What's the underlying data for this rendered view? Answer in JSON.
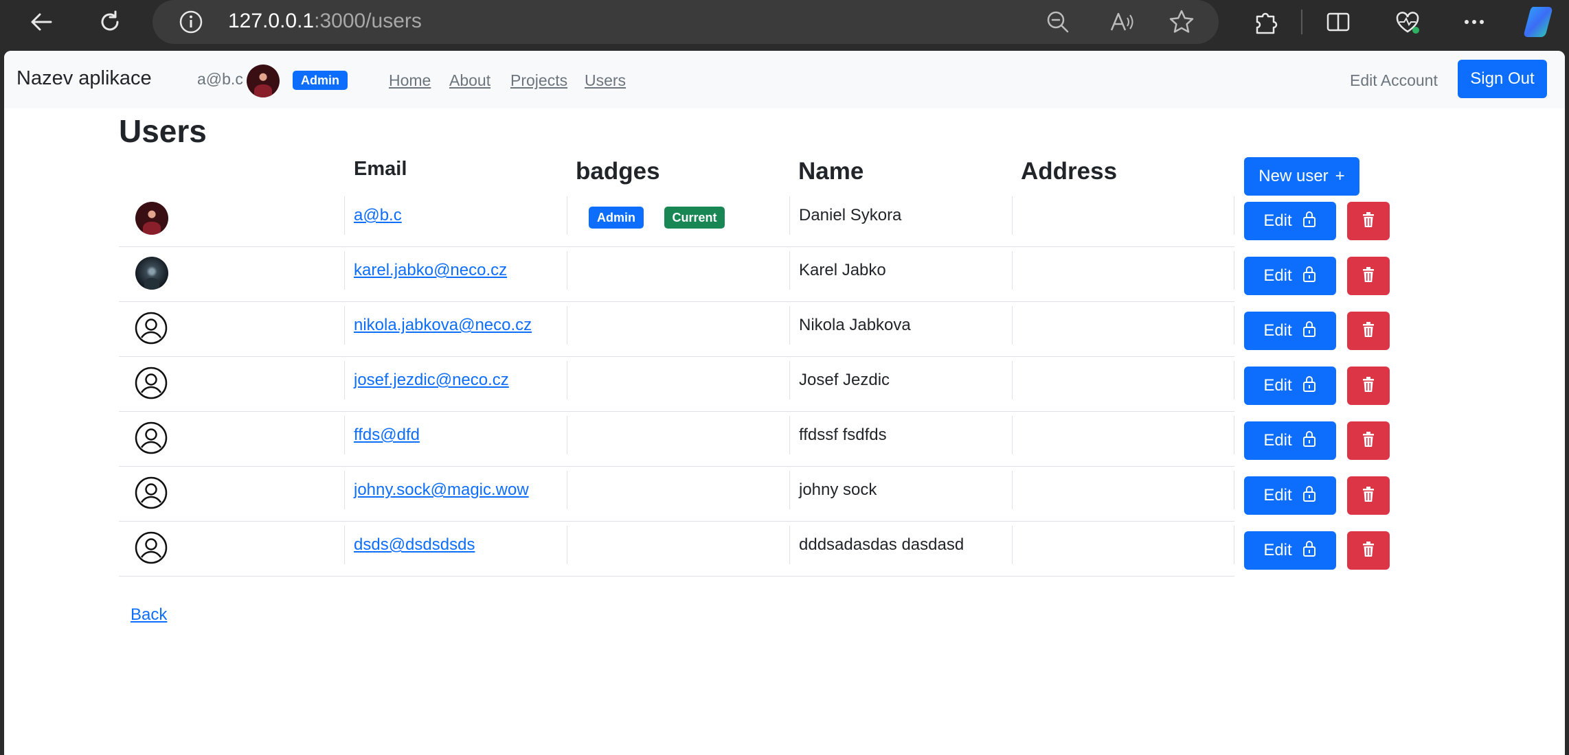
{
  "browser": {
    "url_host": "127.0.0.1",
    "url_rest": ":3000/users"
  },
  "navbar": {
    "brand": "Nazev aplikace",
    "user_email": "a@b.c",
    "role_badge": "Admin",
    "links": [
      "Home",
      "About",
      "Projects",
      "Users"
    ],
    "edit_account": "Edit Account",
    "sign_out": "Sign Out"
  },
  "page": {
    "title": "Users",
    "new_user_label": "New user",
    "new_user_icon": "+",
    "back_label": "Back"
  },
  "table": {
    "headers": {
      "email": "Email",
      "badges": "badges",
      "name": "Name",
      "address": "Address"
    },
    "rows": [
      {
        "avatar": "photo-red",
        "email": "a@b.c",
        "badges": [
          "Admin",
          "Current"
        ],
        "name": "Daniel Sykora",
        "address": ""
      },
      {
        "avatar": "photo-dark",
        "email": "karel.jabko@neco.cz",
        "badges": [],
        "name": "Karel Jabko",
        "address": ""
      },
      {
        "avatar": "default",
        "email": "nikola.jabkova@neco.cz",
        "badges": [],
        "name": "Nikola Jabkova",
        "address": ""
      },
      {
        "avatar": "default",
        "email": "josef.jezdic@neco.cz",
        "badges": [],
        "name": "Josef Jezdic",
        "address": ""
      },
      {
        "avatar": "default",
        "email": "ffds@dfd",
        "badges": [],
        "name": "ffdssf fsdfds",
        "address": ""
      },
      {
        "avatar": "default",
        "email": "johny.sock@magic.wow",
        "badges": [],
        "name": "johny sock",
        "address": ""
      },
      {
        "avatar": "default",
        "email": "dsds@dsdsdsds",
        "badges": [],
        "name": "dddsadasdas dasdasd",
        "address": ""
      }
    ],
    "edit_label": "Edit"
  },
  "colors": {
    "primary": "#0d6efd",
    "danger": "#dc3545",
    "success": "#198754",
    "navbar_bg": "#f8f9fa"
  },
  "icons": {
    "row_edit_icon": "lock-icon",
    "row_delete_icon": "trash-icon",
    "default_avatar": "user-circle-icon"
  }
}
